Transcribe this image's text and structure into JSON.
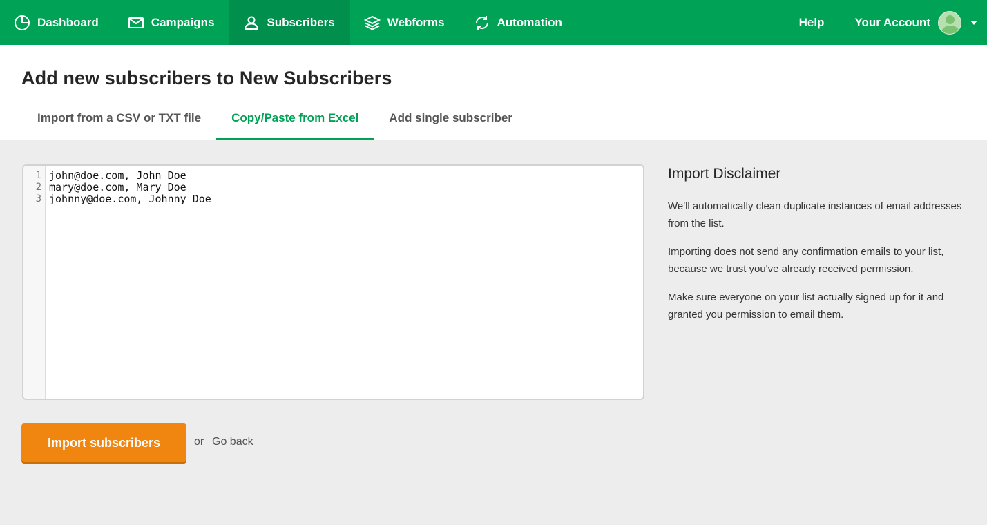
{
  "nav": {
    "items": [
      {
        "label": "Dashboard",
        "icon": "dashboard-pie-icon"
      },
      {
        "label": "Campaigns",
        "icon": "envelope-icon"
      },
      {
        "label": "Subscribers",
        "icon": "user-icon"
      },
      {
        "label": "Webforms",
        "icon": "layers-icon"
      },
      {
        "label": "Automation",
        "icon": "refresh-icon"
      }
    ],
    "active": "Subscribers",
    "help_label": "Help",
    "account_label": "Your Account"
  },
  "header": {
    "title": "Add new subscribers to New Subscribers",
    "tabs": [
      {
        "label": "Import from a CSV or TXT file"
      },
      {
        "label": "Copy/Paste from Excel"
      },
      {
        "label": "Add single subscriber"
      }
    ],
    "active_tab": "Copy/Paste from Excel"
  },
  "editor": {
    "lines": [
      {
        "number": "1",
        "text": "john@doe.com, John Doe"
      },
      {
        "number": "2",
        "text": "mary@doe.com, Mary Doe"
      },
      {
        "number": "3",
        "text": "johnny@doe.com, Johnny Doe"
      }
    ]
  },
  "disclaimer": {
    "title": "Import Disclaimer",
    "paragraphs": [
      "We'll automatically clean duplicate instances of email addresses from the list.",
      "Importing does not send any confirmation emails to your list, because we trust you've already received permission.",
      "Make sure everyone on your list actually signed up for it and granted you permission to email them."
    ]
  },
  "actions": {
    "import_label": "Import subscribers",
    "or_text": "or",
    "go_back_label": "Go back"
  },
  "colors": {
    "brand_green": "#00a356",
    "active_nav": "#008f4c",
    "button_orange": "#f0850f"
  }
}
